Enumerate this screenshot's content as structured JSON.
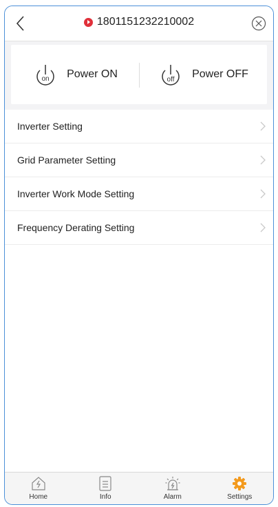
{
  "header": {
    "device_id": "1801151232210002"
  },
  "power": {
    "on_label": "Power ON",
    "off_label": "Power OFF",
    "on_icon_text": "on",
    "off_icon_text": "off"
  },
  "settings": {
    "items": [
      {
        "label": "Inverter Setting"
      },
      {
        "label": "Grid Parameter Setting"
      },
      {
        "label": "Inverter Work Mode Setting"
      },
      {
        "label": "Frequency Derating Setting"
      }
    ]
  },
  "tabs": [
    {
      "label": "Home",
      "icon": "home-icon",
      "active": false
    },
    {
      "label": "Info",
      "icon": "info-icon",
      "active": false
    },
    {
      "label": "Alarm",
      "icon": "alarm-icon",
      "active": false
    },
    {
      "label": "Settings",
      "icon": "gear-icon",
      "active": true
    }
  ],
  "colors": {
    "accent": "#f39a1e",
    "alert": "#e0303a",
    "frame_border": "#4a8fd8"
  }
}
